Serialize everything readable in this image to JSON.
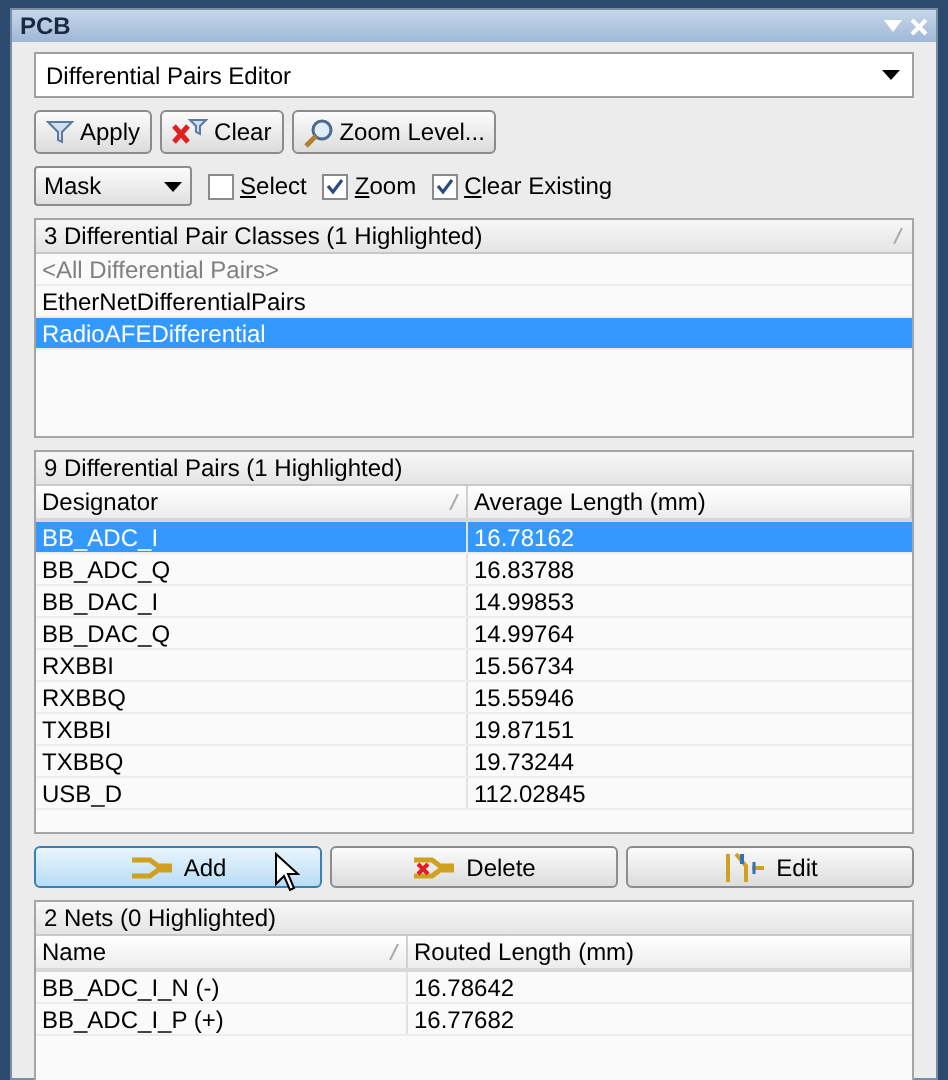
{
  "window": {
    "title": "PCB"
  },
  "mode_select": {
    "value": "Differential Pairs Editor"
  },
  "toolbar": [
    {
      "kind": "apply",
      "label": "Apply"
    },
    {
      "kind": "clear",
      "label": "Clear"
    },
    {
      "kind": "zoom",
      "label": "Zoom Level..."
    }
  ],
  "mask_select": {
    "value": "Mask"
  },
  "options": [
    {
      "label": "Select",
      "checked": false
    },
    {
      "label": "Zoom",
      "checked": true
    },
    {
      "label": "Clear Existing",
      "checked": true
    }
  ],
  "classes": {
    "header": "3 Differential Pair Classes (1 Highlighted)",
    "items": [
      {
        "label": "<All Differential Pairs>",
        "kind": "all",
        "selected": false
      },
      {
        "label": "EtherNetDifferentialPairs",
        "kind": "class",
        "selected": false
      },
      {
        "label": "RadioAFEDifferential",
        "kind": "class",
        "selected": true
      }
    ]
  },
  "pairs": {
    "header": "9 Differential Pairs (1 Highlighted)",
    "columns": [
      "Designator",
      "Average Length (mm)"
    ],
    "rows": [
      {
        "cells": [
          "BB_ADC_I",
          "16.78162"
        ],
        "selected": true
      },
      {
        "cells": [
          "BB_ADC_Q",
          "16.83788"
        ],
        "selected": false
      },
      {
        "cells": [
          "BB_DAC_I",
          "14.99853"
        ],
        "selected": false
      },
      {
        "cells": [
          "BB_DAC_Q",
          "14.99764"
        ],
        "selected": false
      },
      {
        "cells": [
          "RXBBI",
          "15.56734"
        ],
        "selected": false
      },
      {
        "cells": [
          "RXBBQ",
          "15.55946"
        ],
        "selected": false
      },
      {
        "cells": [
          "TXBBI",
          "19.87151"
        ],
        "selected": false
      },
      {
        "cells": [
          "TXBBQ",
          "19.73244"
        ],
        "selected": false
      },
      {
        "cells": [
          "USB_D",
          "112.02845"
        ],
        "selected": false
      }
    ]
  },
  "pair_buttons": [
    {
      "kind": "add",
      "label": "Add",
      "hovered": true
    },
    {
      "kind": "delete",
      "label": "Delete",
      "hovered": false
    },
    {
      "kind": "edit",
      "label": "Edit",
      "hovered": false
    }
  ],
  "nets": {
    "header": "2 Nets (0 Highlighted)",
    "columns": [
      "Name",
      "Routed Length (mm)"
    ],
    "rows": [
      {
        "cells": [
          "BB_ADC_I_N (-)",
          "16.78642"
        ],
        "selected": false
      },
      {
        "cells": [
          "BB_ADC_I_P (+)",
          "16.77682"
        ],
        "selected": false
      }
    ]
  }
}
